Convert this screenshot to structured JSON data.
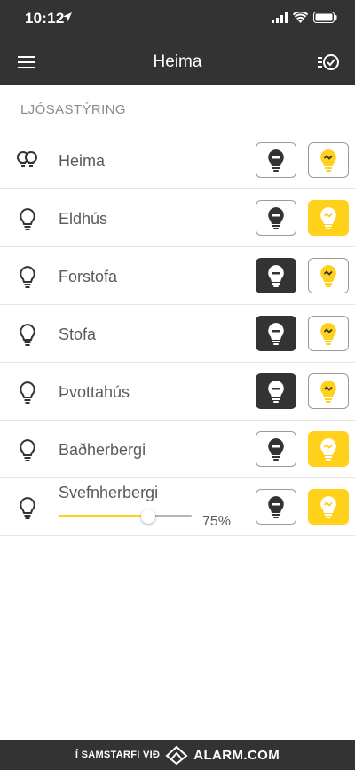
{
  "status_bar": {
    "time": "10:12"
  },
  "header": {
    "title": "Heima"
  },
  "section_title": "LJÓSASTÝRING",
  "rows": [
    {
      "label": "Heima",
      "icon": "group-bulb-icon",
      "state": "mixed"
    },
    {
      "label": "Eldhús",
      "icon": "bulb-outline-icon",
      "state": "on"
    },
    {
      "label": "Forstofa",
      "icon": "bulb-outline-icon",
      "state": "off"
    },
    {
      "label": "Stofa",
      "icon": "bulb-outline-icon",
      "state": "off"
    },
    {
      "label": "Þvottahús",
      "icon": "bulb-outline-icon",
      "state": "off"
    },
    {
      "label": "Baðherbergi",
      "icon": "bulb-outline-icon",
      "state": "on"
    },
    {
      "label": "Svefnherbergi",
      "icon": "bulb-outline-icon",
      "state": "on",
      "dimmer": {
        "value": 0.67,
        "display": "75%"
      }
    }
  ],
  "footer": {
    "partner_text": "Í SAMSTARFI VIÐ",
    "brand": "ALARM.COM"
  },
  "colors": {
    "bar": "#333333",
    "accent": "#ffd11a",
    "text": "#5a5a5a"
  }
}
